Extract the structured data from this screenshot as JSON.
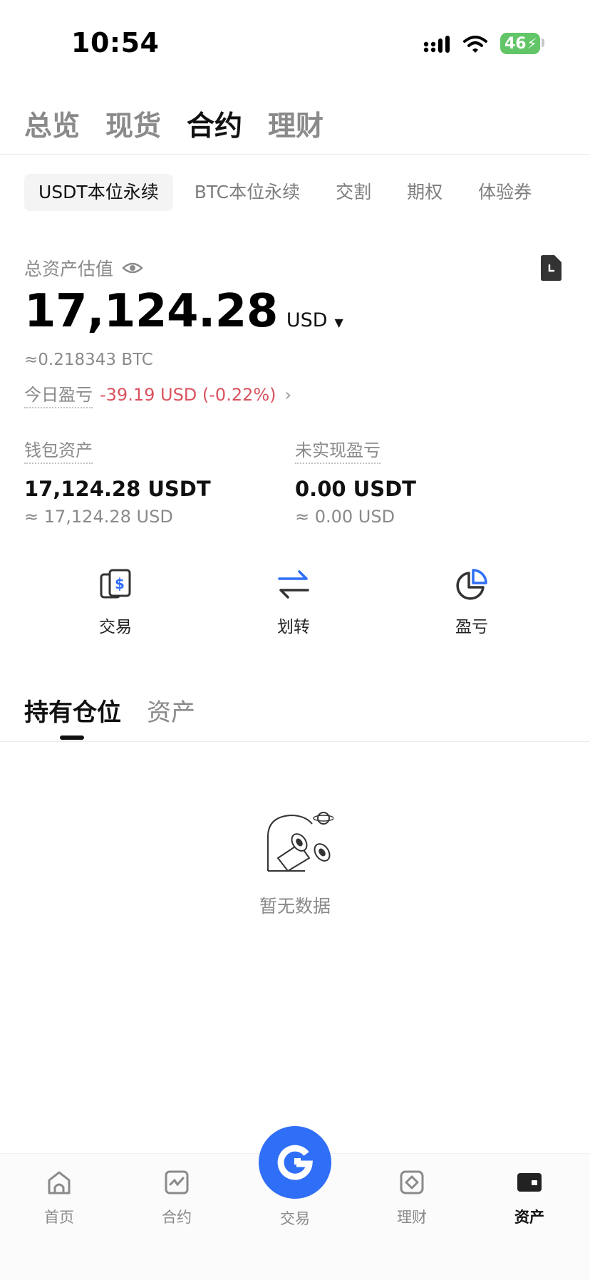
{
  "status_bar": {
    "time": "10:54",
    "battery": "46"
  },
  "top_tabs": [
    {
      "label": "总览",
      "active": false
    },
    {
      "label": "现货",
      "active": false
    },
    {
      "label": "合约",
      "active": true
    },
    {
      "label": "理财",
      "active": false
    }
  ],
  "sub_tabs": [
    {
      "label": "USDT本位永续",
      "active": true
    },
    {
      "label": "BTC本位永续",
      "active": false
    },
    {
      "label": "交割",
      "active": false
    },
    {
      "label": "期权",
      "active": false
    },
    {
      "label": "体验券",
      "active": false
    }
  ],
  "summary": {
    "label": "总资产估值",
    "value": "17,124.28",
    "currency": "USD",
    "btc_equiv": "≈0.218343 BTC",
    "pnl_label": "今日盈亏",
    "pnl_value": "-39.19 USD (-0.22%)"
  },
  "wallet": {
    "label": "钱包资产",
    "value": "17,124.28 USDT",
    "sub": "≈ 17,124.28 USD"
  },
  "unrealized": {
    "label": "未实现盈亏",
    "value": "0.00 USDT",
    "sub": "≈ 0.00 USD"
  },
  "actions": [
    {
      "label": "交易",
      "icon": "trade-dollar-icon"
    },
    {
      "label": "划转",
      "icon": "transfer-arrows-icon"
    },
    {
      "label": "盈亏",
      "icon": "pie-chart-icon"
    }
  ],
  "position_tabs": [
    {
      "label": "持有仓位",
      "active": true
    },
    {
      "label": "资产",
      "active": false
    }
  ],
  "empty_state": {
    "text": "暂无数据"
  },
  "bottom_nav": [
    {
      "label": "首页",
      "icon": "home-icon",
      "active": false
    },
    {
      "label": "合约",
      "icon": "futures-chart-icon",
      "active": false
    },
    {
      "label": "交易",
      "icon": "trade-logo-icon",
      "active": false
    },
    {
      "label": "理财",
      "icon": "earn-icon",
      "active": false
    },
    {
      "label": "资产",
      "icon": "wallet-icon",
      "active": true
    }
  ],
  "colors": {
    "accent_blue": "#2f6ef6",
    "loss_red": "#d9535f",
    "battery_green": "#62c567"
  }
}
